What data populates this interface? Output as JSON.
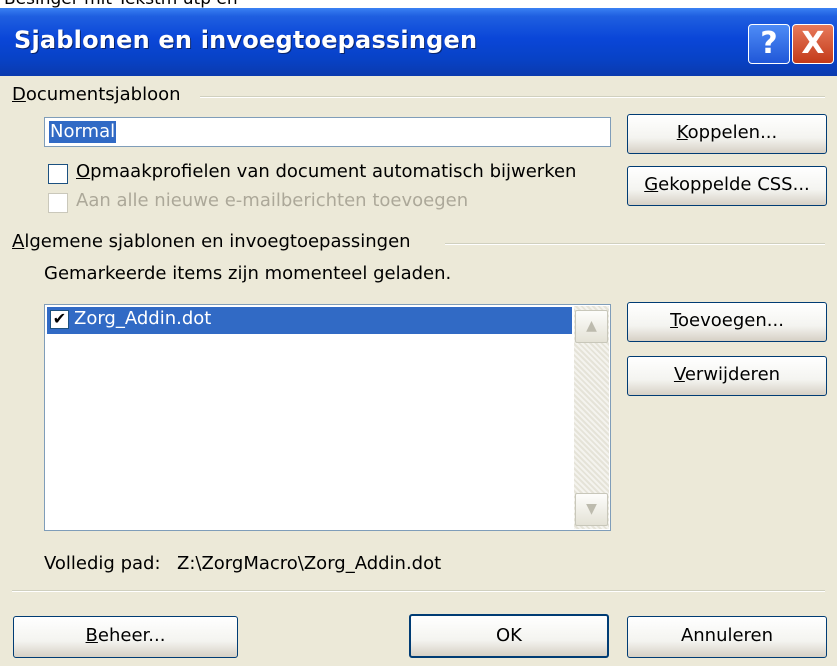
{
  "background_text": "Besinger mit Tekstm utp en",
  "dialog": {
    "title": "Sjablonen en invoegtoepassingen",
    "help_icon": "?",
    "close_icon": "X"
  },
  "document_template": {
    "group_label": "Documentsjabloon",
    "template_value": "Normal",
    "auto_update_label": "Opmaakprofielen van document automatisch bijwerken",
    "auto_update_checked": false,
    "attach_email_label": "Aan alle nieuwe e-mailberichten toevoegen",
    "attach_email_enabled": false,
    "attach_button": "Koppelen...",
    "linked_css_button": "Gekoppelde CSS..."
  },
  "global_templates": {
    "group_label": "Algemene sjablonen en invoegtoepassingen",
    "hint": "Gemarkeerde items zijn momenteel geladen.",
    "items": [
      {
        "label": "Zorg_Addin.dot",
        "checked": true,
        "selected": true
      }
    ],
    "add_button": "Toevoegen...",
    "remove_button": "Verwijderen",
    "full_path_label": "Volledig pad:",
    "full_path_value": "Z:\\ZorgMacro\\Zorg_Addin.dot"
  },
  "footer": {
    "organizer_button": "Beheer...",
    "ok_button": "OK",
    "cancel_button": "Annuleren"
  },
  "colors": {
    "title_bar": "#0A46D8",
    "dialog_face": "#ECE9D8",
    "selection": "#316AC5",
    "disabled_text": "#ACA899"
  }
}
